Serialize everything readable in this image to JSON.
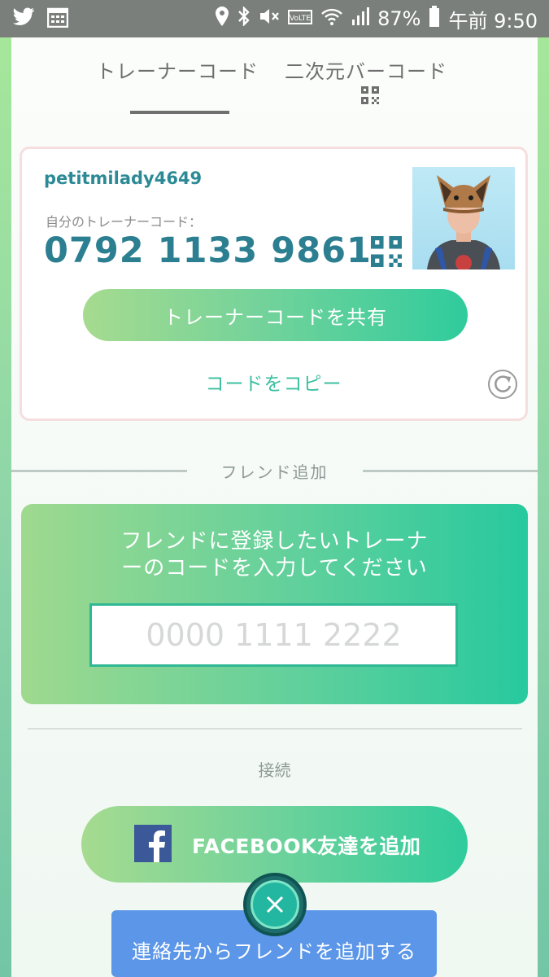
{
  "status_bar": {
    "battery": "87%",
    "time": "午前 9:50",
    "icons": [
      "twitter-icon",
      "calendar-icon",
      "location-icon",
      "bluetooth-icon",
      "mute-icon",
      "volte-icon",
      "wifi-icon",
      "signal-icon",
      "battery-icon"
    ]
  },
  "tabs": [
    {
      "label": "トレーナーコード",
      "selected": true
    },
    {
      "label": "二次元バーコード",
      "selected": false
    }
  ],
  "card": {
    "username": "petitmilady4649",
    "code_label": "自分のトレーナーコード：",
    "code": "0792 1133 9861",
    "share_label": "トレーナーコードを共有",
    "copy_label": "コードをコピー"
  },
  "add_friend": {
    "section_label": "フレンド追加",
    "prompt_line1": "フレンドに登録したいトレーナ",
    "prompt_line2": "ーのコードを入力してください",
    "input_value": "",
    "input_placeholder": "0000 1111 2222"
  },
  "connect": {
    "section_label": "接続",
    "facebook_label": "FACEBOOK友達を追加",
    "contacts_label": "連絡先からフレンドを追加する"
  },
  "colors": {
    "accent_teal": "#2b7f91",
    "green_gradient_start": "#a6db90",
    "green_gradient_end": "#2fcc9c",
    "contacts_blue": "#5b96e8",
    "facebook_blue": "#3b5998"
  }
}
